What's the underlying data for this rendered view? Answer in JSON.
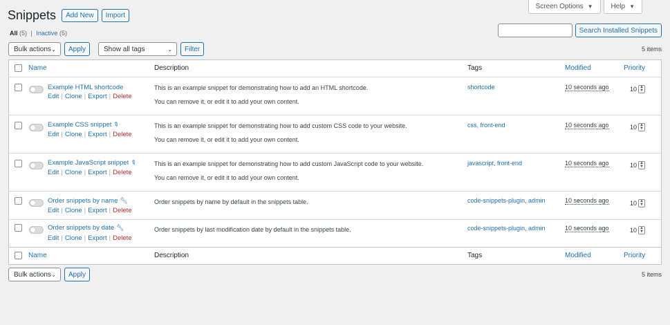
{
  "help_tabs": {
    "screen_options": "Screen Options",
    "help": "Help"
  },
  "page_title": "Snippets",
  "buttons": {
    "add_new": "Add New",
    "import": "Import",
    "search": "Search Installed Snippets",
    "apply": "Apply",
    "filter": "Filter"
  },
  "views": {
    "all": "All",
    "all_count": "(5)",
    "separator": "|",
    "inactive": "Inactive",
    "inactive_count": "(5)"
  },
  "bulk_actions": "Bulk actions",
  "tag_filter": "Show all tags",
  "items_count": "5 items",
  "columns": {
    "name": "Name",
    "description": "Description",
    "tags": "Tags",
    "modified": "Modified",
    "priority": "Priority"
  },
  "row_actions": {
    "edit": "Edit",
    "clone": "Clone",
    "export": "Export",
    "delete": "Delete",
    "sep": "|"
  },
  "snippets": [
    {
      "name": "Example HTML shortcode",
      "desc1": "This is an example snippet for demonstrating how to add an HTML shortcode.",
      "desc2": "You can remove it, or edit it to add your own content.",
      "tags": "shortcode",
      "modified": "10 seconds ago",
      "priority": "10",
      "icon": "none"
    },
    {
      "name": "Example CSS snippet",
      "desc1": "This is an example snippet for demonstrating how to add custom CSS code to your website.",
      "desc2": "You can remove it, or edit it to add your own content.",
      "tags": "css, front-end",
      "modified": "10 seconds ago",
      "priority": "10",
      "icon": "pin-icon"
    },
    {
      "name": "Example JavaScript snippet",
      "desc1": "This is an example snippet for demonstrating how to add custom JavaScript code to your website.",
      "desc2": "You can remove it, or edit it to add your own content.",
      "tags": "javascript, front-end",
      "modified": "10 seconds ago",
      "priority": "10",
      "icon": "pin-icon"
    },
    {
      "name": "Order snippets by name",
      "desc1": "Order snippets by name by default in the snippets table.",
      "desc2": "",
      "tags": "code-snippets-plugin, admin",
      "modified": "10 seconds ago",
      "priority": "10",
      "icon": "wrench-icon"
    },
    {
      "name": "Order snippets by date",
      "desc1": "Order snippets by last modification date by default in the snippets table.",
      "desc2": "",
      "tags": "code-snippets-plugin, admin",
      "modified": "10 seconds ago",
      "priority": "10",
      "icon": "wrench-icon"
    }
  ],
  "colors": {
    "accent": "#2271b1",
    "delete": "#b32d2e",
    "background": "#f0f0f1"
  }
}
